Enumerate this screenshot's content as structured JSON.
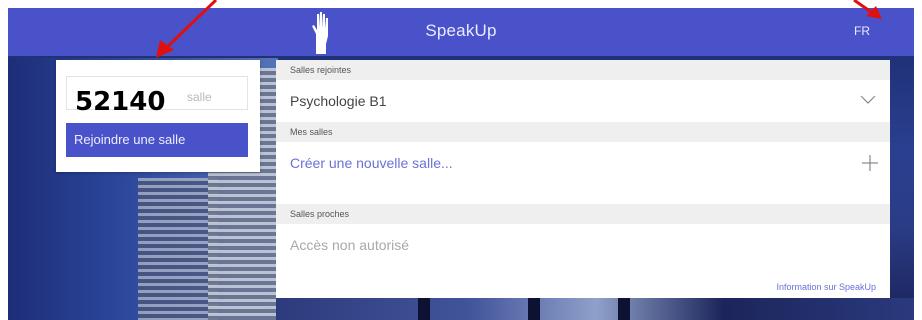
{
  "header": {
    "title": "SpeakUp",
    "language": "FR"
  },
  "join": {
    "room_code": "52140",
    "placeholder": "salle",
    "button_label": "Rejoindre une salle"
  },
  "rooms": {
    "joined_header": "Salles rejointes",
    "joined_room": "Psychologie B1",
    "my_rooms_header": "Mes salles",
    "create_room": "Créer une nouvelle salle...",
    "nearby_header": "Salles proches",
    "nearby_status": "Accès non autorisé",
    "info_link": "Information sur SpeakUp"
  },
  "colors": {
    "accent": "#4a52c9",
    "annotation_arrow": "#e01010"
  }
}
